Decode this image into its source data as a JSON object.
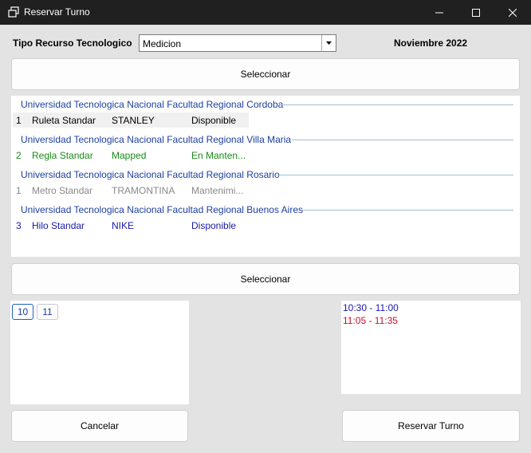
{
  "window": {
    "title": "Reservar Turno"
  },
  "header": {
    "tipo_label": "Tipo Recurso Tecnologico",
    "tipo_value": "Medicion",
    "month_label": "Noviembre 2022"
  },
  "buttons": {
    "select_top": "Seleccionar",
    "select_mid": "Seleccionar",
    "cancel": "Cancelar",
    "reserve": "Reservar Turno"
  },
  "groups": [
    {
      "name": "Universidad Tecnologica Nacional Facultad Regional Cordoba",
      "rows": [
        {
          "num": "1",
          "type": "Ruleta Standar",
          "brand": "STANLEY",
          "state": "Disponible",
          "color": "#000000"
        }
      ]
    },
    {
      "name": "Universidad Tecnologica Nacional Facultad Regional Villa Maria",
      "rows": [
        {
          "num": "2",
          "type": "Regla Standar",
          "brand": "Mapped",
          "state": "En Manten...",
          "color": "#1a8a1a"
        }
      ]
    },
    {
      "name": "Universidad Tecnologica Nacional Facultad Regional Rosario",
      "rows": [
        {
          "num": "1",
          "type": "Metro Standar",
          "brand": "TRAMONTINA",
          "state": "Mantenimi...",
          "color": "#8a8a8a"
        }
      ]
    },
    {
      "name": "Universidad Tecnologica Nacional Facultad Regional Buenos Aires",
      "rows": [
        {
          "num": "3",
          "type": "Hilo Standar",
          "brand": "NIKE",
          "state": "Disponible",
          "color": "#1a1aa8"
        }
      ]
    }
  ],
  "days": [
    "10",
    "11"
  ],
  "times": [
    {
      "label": "10:30 - 11:00",
      "color": "#1a1aa8"
    },
    {
      "label": "11:05 - 11:35",
      "color": "#c8102e"
    }
  ]
}
